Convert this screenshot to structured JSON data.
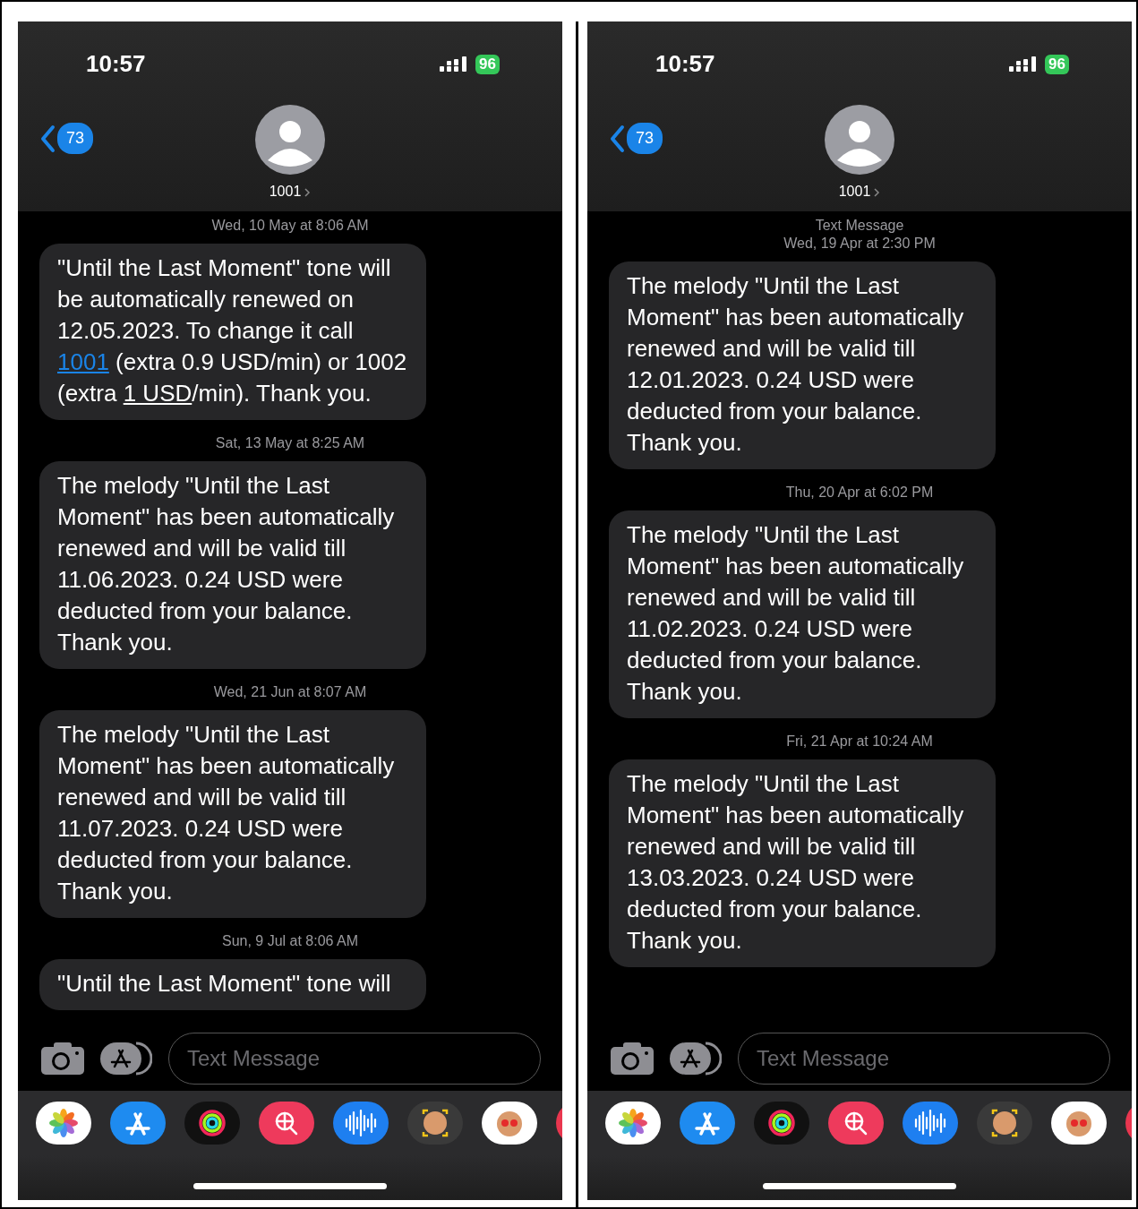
{
  "phones": [
    {
      "status_bar": {
        "time": "10:57",
        "battery": "96"
      },
      "header": {
        "back_badge": "73",
        "contact": "1001"
      },
      "conversation": [
        {
          "kind": "timestamp",
          "text": "Wed, 10 May at 8:06 AM"
        },
        {
          "kind": "message",
          "parts": [
            {
              "kind": "plain",
              "text": "\"Until the Last Moment\" tone will be automatically renewed on 12.05.2023. To change it call "
            },
            {
              "kind": "phone-link",
              "text": "1001"
            },
            {
              "kind": "plain",
              "text": " (extra 0.9 USD/min) or 1002 (extra "
            },
            {
              "kind": "data-link",
              "text": "1 USD"
            },
            {
              "kind": "plain",
              "text": "/min). Thank you."
            }
          ]
        },
        {
          "kind": "timestamp",
          "text": "Sat, 13 May at 8:25 AM"
        },
        {
          "kind": "message",
          "parts": [
            {
              "kind": "plain",
              "text": "The melody \"Until the Last Moment\" has been automatically renewed and will be valid till 11.06.2023. 0.24 USD were deducted from your balance. Thank you."
            }
          ]
        },
        {
          "kind": "timestamp",
          "text": "Wed, 21 Jun at 8:07 AM"
        },
        {
          "kind": "message",
          "parts": [
            {
              "kind": "plain",
              "text": "The melody \"Until the Last Moment\" has been automatically renewed and will be valid till 11.07.2023. 0.24 USD were deducted from your balance. Thank you."
            }
          ]
        },
        {
          "kind": "timestamp",
          "text": "Sun, 9 Jul at 8:06 AM"
        },
        {
          "kind": "message",
          "parts": [
            {
              "kind": "plain",
              "text": "\"Until the Last Moment\" tone will"
            }
          ]
        }
      ],
      "composer": {
        "placeholder": "Text Message"
      }
    },
    {
      "status_bar": {
        "time": "10:57",
        "battery": "96"
      },
      "header": {
        "back_badge": "73",
        "contact": "1001"
      },
      "conversation": [
        {
          "kind": "service-label",
          "text": "Text Message"
        },
        {
          "kind": "timestamp",
          "text": "Wed, 19 Apr at 2:30 PM"
        },
        {
          "kind": "message",
          "parts": [
            {
              "kind": "plain",
              "text": "The melody \"Until the Last Moment\" has been automatically renewed and will be valid till 12.01.2023. 0.24 USD were deducted from your balance. Thank you."
            }
          ]
        },
        {
          "kind": "timestamp",
          "text": "Thu, 20 Apr at 6:02 PM"
        },
        {
          "kind": "message",
          "parts": [
            {
              "kind": "plain",
              "text": "The melody \"Until the Last Moment\" has been automatically renewed and will be valid till 11.02.2023. 0.24 USD were deducted from your balance. Thank you."
            }
          ]
        },
        {
          "kind": "timestamp",
          "text": "Fri, 21 Apr at 10:24 AM"
        },
        {
          "kind": "message",
          "parts": [
            {
              "kind": "plain",
              "text": "The melody \"Until the Last Moment\" has been automatically renewed and will be valid till 13.03.2023. 0.24 USD were deducted from your balance. Thank you."
            }
          ]
        }
      ],
      "composer": {
        "placeholder": "Text Message"
      }
    }
  ]
}
